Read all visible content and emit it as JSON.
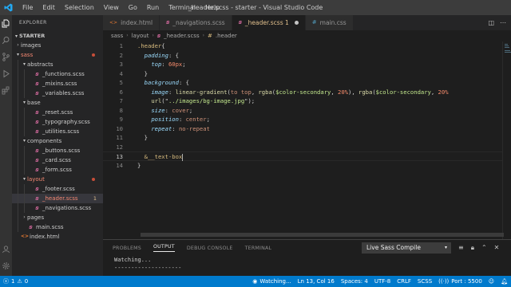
{
  "titlebar": {
    "menu": [
      "File",
      "Edit",
      "Selection",
      "View",
      "Go",
      "Run",
      "Terminal",
      "Help"
    ],
    "title": "_header.scss - starter - Visual Studio Code"
  },
  "sidebar": {
    "header": "EXPLORER",
    "section": "STARTER",
    "items": [
      {
        "label": "images",
        "type": "folder",
        "open": false,
        "depth": 1
      },
      {
        "label": "sass",
        "type": "folder",
        "open": true,
        "depth": 1,
        "status": "error-dot"
      },
      {
        "label": "abstracts",
        "type": "folder",
        "open": true,
        "depth": 2
      },
      {
        "label": "_functions.scss",
        "type": "scss",
        "depth": 3
      },
      {
        "label": "_mixins.scss",
        "type": "scss",
        "depth": 3
      },
      {
        "label": "_variables.scss",
        "type": "scss",
        "depth": 3
      },
      {
        "label": "base",
        "type": "folder",
        "open": true,
        "depth": 2
      },
      {
        "label": "_reset.scss",
        "type": "scss",
        "depth": 3
      },
      {
        "label": "_typography.scss",
        "type": "scss",
        "depth": 3
      },
      {
        "label": "_utilities.scss",
        "type": "scss",
        "depth": 3
      },
      {
        "label": "components",
        "type": "folder",
        "open": true,
        "depth": 2
      },
      {
        "label": "_buttons.scss",
        "type": "scss",
        "depth": 3
      },
      {
        "label": "_card.scss",
        "type": "scss",
        "depth": 3
      },
      {
        "label": "_form.scss",
        "type": "scss",
        "depth": 3
      },
      {
        "label": "layout",
        "type": "folder",
        "open": true,
        "depth": 2,
        "status": "error-dot"
      },
      {
        "label": "_footer.scss",
        "type": "scss",
        "depth": 3
      },
      {
        "label": "_header.scss",
        "type": "scss",
        "depth": 3,
        "selected": true,
        "badge": "1"
      },
      {
        "label": "_navigations.scss",
        "type": "scss",
        "depth": 3
      },
      {
        "label": "pages",
        "type": "folder",
        "open": false,
        "depth": 2
      },
      {
        "label": "main.scss",
        "type": "scss",
        "depth": 2
      },
      {
        "label": "index.html",
        "type": "html",
        "depth": 1
      }
    ]
  },
  "tabs": [
    {
      "label": "index.html",
      "icon": "html",
      "active": false
    },
    {
      "label": "_navigations.scss",
      "icon": "scss",
      "active": false
    },
    {
      "label": "_header.scss 1",
      "icon": "scss",
      "active": true,
      "dirty": true
    },
    {
      "label": "main.css",
      "icon": "css",
      "active": false
    }
  ],
  "breadcrumb": [
    "sass",
    "layout",
    "_header.scss",
    ".header"
  ],
  "editor": {
    "current_line": 13,
    "lines": [
      [
        {
          "t": ".header",
          "c": "sel"
        },
        {
          "t": "{",
          "c": "punc"
        }
      ],
      [
        {
          "t": "  "
        },
        {
          "t": "padding",
          "c": "prop"
        },
        {
          "t": ": {",
          "c": "punc"
        }
      ],
      [
        {
          "t": "    "
        },
        {
          "t": "top",
          "c": "prop"
        },
        {
          "t": ": ",
          "c": "punc"
        },
        {
          "t": "60px",
          "c": "num-em"
        },
        {
          "t": ";",
          "c": "punc"
        }
      ],
      [
        {
          "t": "  }",
          "c": "punc"
        }
      ],
      [
        {
          "t": "  "
        },
        {
          "t": "background",
          "c": "prop"
        },
        {
          "t": ": {",
          "c": "punc"
        }
      ],
      [
        {
          "t": "    "
        },
        {
          "t": "image",
          "c": "prop"
        },
        {
          "t": ": ",
          "c": "punc"
        },
        {
          "t": "linear-gradient",
          "c": "fn"
        },
        {
          "t": "(",
          "c": "punc"
        },
        {
          "t": "to top",
          "c": "val"
        },
        {
          "t": ", ",
          "c": "punc"
        },
        {
          "t": "rgba",
          "c": "fn"
        },
        {
          "t": "(",
          "c": "punc"
        },
        {
          "t": "$color-secondary",
          "c": "var"
        },
        {
          "t": ", ",
          "c": "punc"
        },
        {
          "t": "20%",
          "c": "num-em"
        },
        {
          "t": "), ",
          "c": "punc"
        },
        {
          "t": "rgba",
          "c": "fn"
        },
        {
          "t": "(",
          "c": "punc"
        },
        {
          "t": "$color-secondary",
          "c": "var"
        },
        {
          "t": ", ",
          "c": "punc"
        },
        {
          "t": "20%",
          "c": "num-em"
        }
      ],
      [
        {
          "t": "    "
        },
        {
          "t": "url",
          "c": "fn"
        },
        {
          "t": "(\"",
          "c": "punc"
        },
        {
          "t": "../images/bg-image.jpg",
          "c": "str"
        },
        {
          "t": "\");",
          "c": "punc"
        }
      ],
      [
        {
          "t": "    "
        },
        {
          "t": "size",
          "c": "prop"
        },
        {
          "t": ": ",
          "c": "punc"
        },
        {
          "t": "cover",
          "c": "val"
        },
        {
          "t": ";",
          "c": "punc"
        }
      ],
      [
        {
          "t": "    "
        },
        {
          "t": "position",
          "c": "prop"
        },
        {
          "t": ": ",
          "c": "punc"
        },
        {
          "t": "center",
          "c": "val"
        },
        {
          "t": ";",
          "c": "punc"
        }
      ],
      [
        {
          "t": "    "
        },
        {
          "t": "repeat",
          "c": "prop"
        },
        {
          "t": ": ",
          "c": "punc"
        },
        {
          "t": "no-repeat",
          "c": "val"
        }
      ],
      [
        {
          "t": "  }",
          "c": "punc"
        }
      ],
      [],
      [
        {
          "t": "  "
        },
        {
          "t": "&__text-box",
          "c": "sel"
        }
      ],
      [
        {
          "t": "}",
          "c": "punc"
        }
      ]
    ]
  },
  "panel": {
    "tabs": [
      "PROBLEMS",
      "OUTPUT",
      "DEBUG CONSOLE",
      "TERMINAL"
    ],
    "active_tab": "OUTPUT",
    "select_value": "Live Sass Compile",
    "output_lines": [
      "Watching...",
      "--------------------"
    ]
  },
  "statusbar": {
    "errors": "1",
    "warnings": "0",
    "watching": "Watching...",
    "position": "Ln 13, Col 16",
    "spaces": "Spaces: 4",
    "encoding": "UTF-8",
    "eol": "CRLF",
    "language": "SCSS",
    "port": "Port : 5500"
  },
  "colors": {
    "statusbar": "#007acc",
    "activitybar": "#333333",
    "sidebar": "#252526",
    "editor": "#1e1e1e",
    "modified": "#e2c08d",
    "error": "#c74e39"
  }
}
